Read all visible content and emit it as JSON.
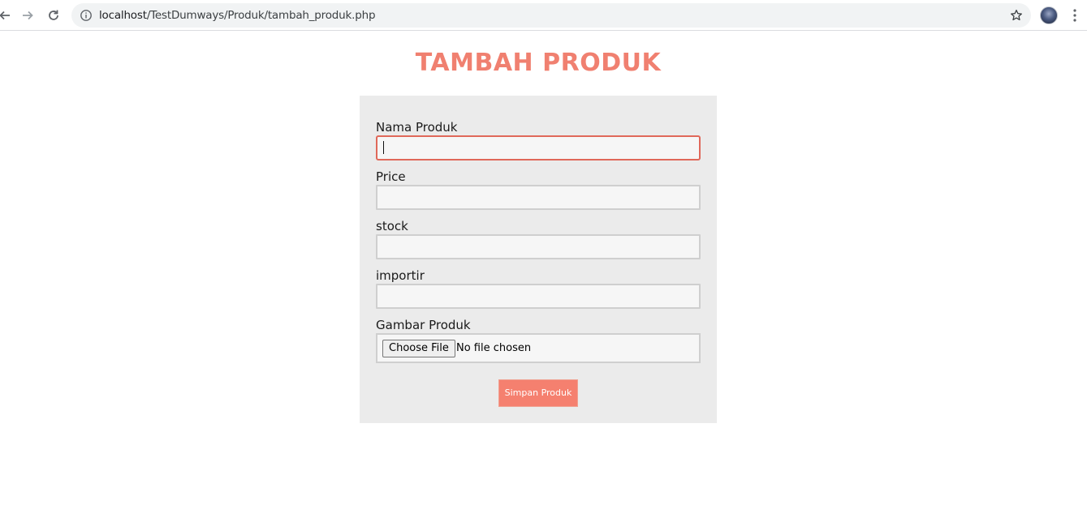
{
  "browser": {
    "url_host": "localhost",
    "url_path": "/TestDumways/Produk/tambah_produk.php",
    "icons": {
      "back": "back-arrow-icon",
      "forward": "forward-arrow-icon",
      "reload": "reload-icon",
      "info": "info-icon",
      "bookmark": "star-icon",
      "profile": "avatar",
      "menu": "kebab-menu-icon"
    }
  },
  "page": {
    "title": "TAMBAH PRODUK",
    "accent_color": "#f08070"
  },
  "form": {
    "fields": [
      {
        "label": "Nama Produk",
        "value": "",
        "placeholder": "",
        "focused": true
      },
      {
        "label": "Price",
        "value": "",
        "placeholder": ""
      },
      {
        "label": "stock",
        "value": "",
        "placeholder": ""
      },
      {
        "label": "importir",
        "value": "",
        "placeholder": ""
      }
    ],
    "file_field": {
      "label": "Gambar Produk",
      "button_label": "Choose File",
      "status": "No file chosen"
    },
    "submit_label": "Simpan Produk"
  }
}
